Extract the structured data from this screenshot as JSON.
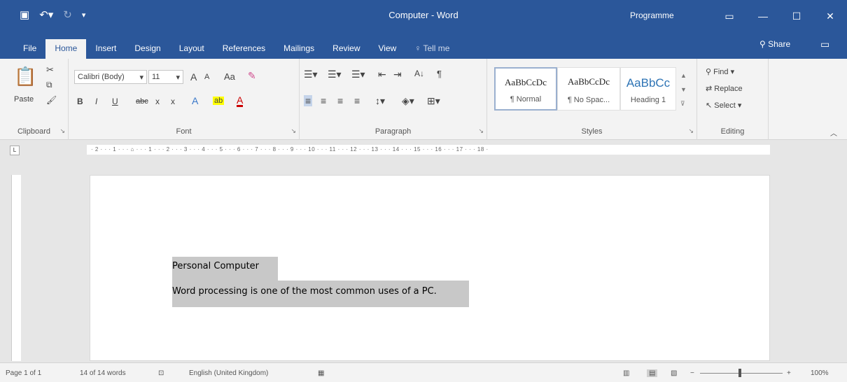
{
  "title_bar": {
    "title": "Computer - Word",
    "account": "Programme",
    "qat": {
      "save_icon": "save-icon",
      "undo_icon": "undo-icon",
      "redo_icon": "redo-icon",
      "customize_icon": "customize-icon"
    }
  },
  "tabs": [
    "File",
    "Home",
    "Insert",
    "Design",
    "Layout",
    "References",
    "Mailings",
    "Review",
    "View"
  ],
  "active_tab": "Home",
  "tell_me": "Tell me",
  "share": "Share",
  "ribbon": {
    "clipboard": {
      "label": "Clipboard",
      "paste": "Paste"
    },
    "font": {
      "label": "Font",
      "font_name": "Calibri (Body)",
      "font_size": "11",
      "grow": "A",
      "shrink": "A",
      "case": "Aa",
      "bold": "B",
      "italic": "I",
      "underline": "U",
      "strike": "abc",
      "subscript": "x",
      "superscript": "x",
      "text_effects": "A",
      "highlight": "ab",
      "font_color": "A"
    },
    "paragraph": {
      "label": "Paragraph",
      "sort": "A↓",
      "pilcrow": "¶"
    },
    "styles": {
      "label": "Styles",
      "items": [
        {
          "sample": "AaBbCcDc",
          "name": "¶ Normal"
        },
        {
          "sample": "AaBbCcDc",
          "name": "¶ No Spac..."
        },
        {
          "sample": "AaBbCc",
          "name": "Heading 1"
        }
      ]
    },
    "editing": {
      "label": "Editing",
      "find": "Find",
      "replace": "Replace",
      "select": "Select"
    }
  },
  "document": {
    "line1": "Personal Computer",
    "line2": "Word processing is one of the most common uses of a PC."
  },
  "status_bar": {
    "page": "Page 1 of 1",
    "words": "14 of 14 words",
    "language": "English (United Kingdom)",
    "zoom": "100%"
  },
  "colors": {
    "brand": "#2b579a",
    "selection": "#c8c8c8"
  }
}
